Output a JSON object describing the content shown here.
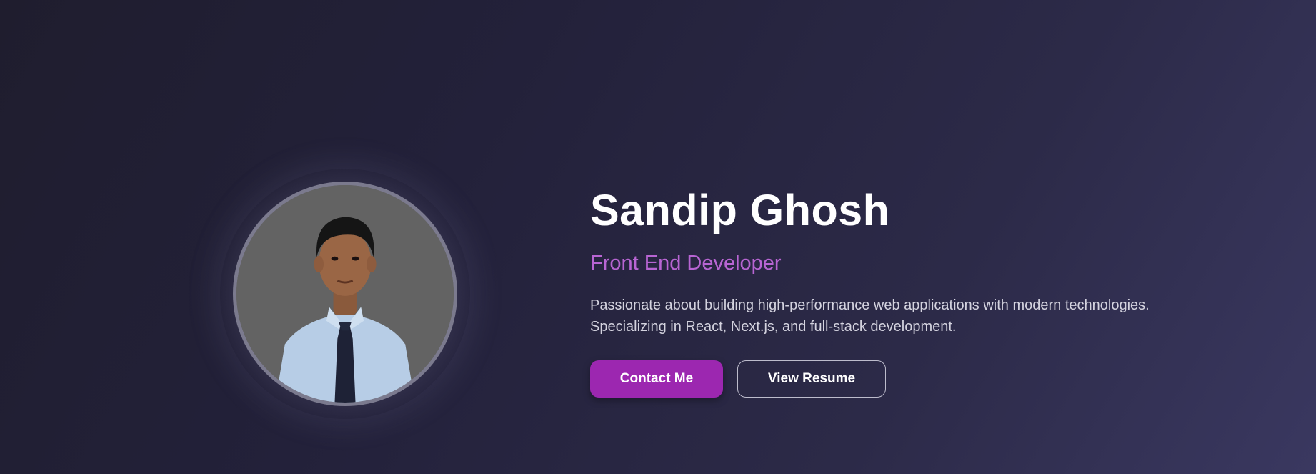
{
  "profile": {
    "name": "Sandip Ghosh",
    "role": "Front End Developer",
    "description": "Passionate about building high-performance web applications with modern technologies. Specializing in React, Next.js, and full-stack development.",
    "photo_alt": "Sandip Ghosh profile photo"
  },
  "actions": {
    "contact_label": "Contact Me",
    "resume_label": "View Resume"
  },
  "colors": {
    "accent": "#9c27b0",
    "role_text": "#b865d3",
    "background_start": "#1f1d2e",
    "background_end": "#3a3860"
  }
}
